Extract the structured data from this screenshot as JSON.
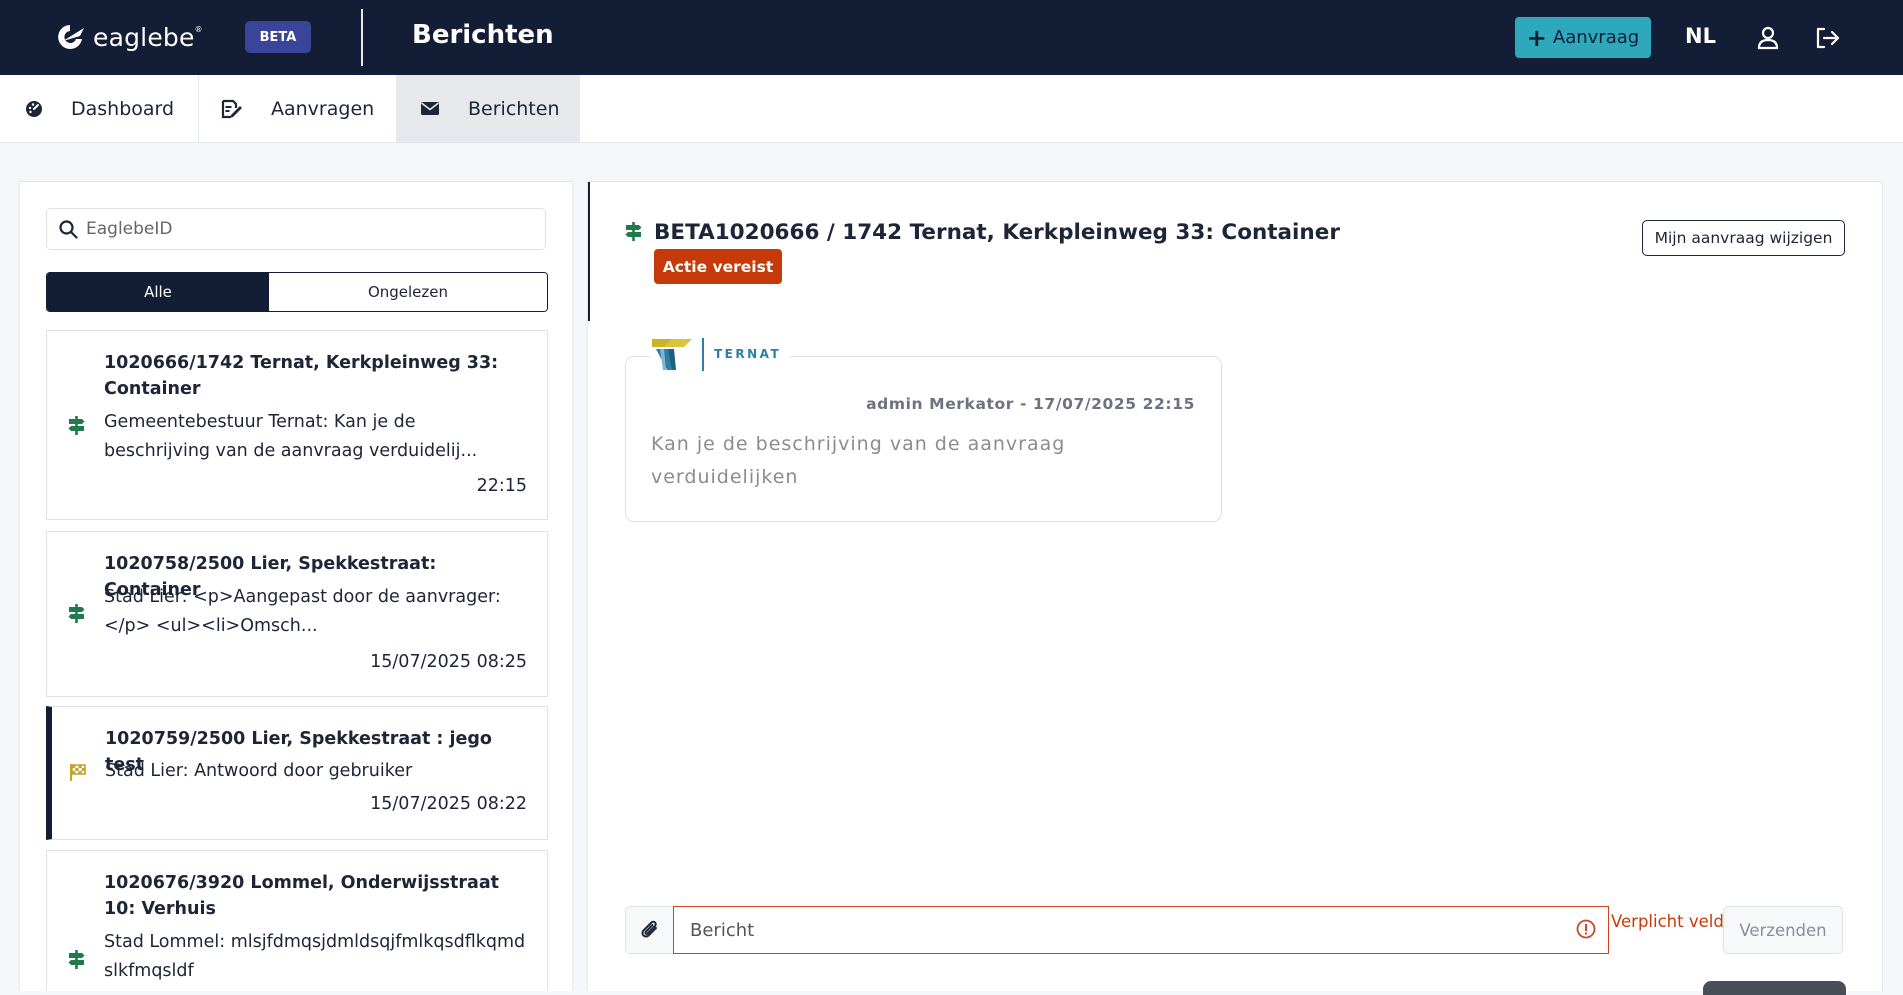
{
  "header": {
    "logo_text": "eaglebe",
    "logo_reg": "®",
    "beta_badge": "BETA",
    "page_title": "Berichten",
    "new_request_label": "Aanvraag",
    "language": "NL"
  },
  "nav": {
    "tabs": [
      {
        "label": "Dashboard",
        "icon": "dashboard-icon",
        "active": false
      },
      {
        "label": "Aanvragen",
        "icon": "edit-document-icon",
        "active": false
      },
      {
        "label": "Berichten",
        "icon": "envelope-icon",
        "active": true
      }
    ]
  },
  "sidebar": {
    "search_placeholder": "EaglebeID",
    "filters": {
      "all": "Alle",
      "unread": "Ongelezen"
    },
    "messages": [
      {
        "title": "1020666/1742 Ternat, Kerkpleinweg 33: Container",
        "preview": "Gemeentebestuur Ternat: Kan je de beschrijving van de aanvraag verduidelij...",
        "time": "22:15",
        "icon": "signpost-icon",
        "selected": false
      },
      {
        "title": "1020758/2500 Lier, Spekkestraat: Container",
        "preview": "Stad Lier: <p>Aangepast door de aanvrager: </p> <ul><li>Omsch...",
        "time": "15/07/2025 08:25",
        "icon": "signpost-icon",
        "selected": false
      },
      {
        "title": "1020759/2500 Lier, Spekkestraat : jego test",
        "preview": "Stad Lier: Antwoord door gebruiker",
        "time": "15/07/2025 08:22",
        "icon": "checkered-flag-icon",
        "selected": true
      },
      {
        "title": "1020676/3920 Lommel, Onderwijsstraat 10: Verhuis",
        "preview": "Stad Lommel: mlsjfdmqsjdmldsqjfmlkqsdflkqmdslkfmqsldf",
        "time": "",
        "icon": "signpost-icon",
        "selected": false
      }
    ]
  },
  "thread": {
    "title": "BETA1020666 / 1742 Ternat, Kerkpleinweg 33: Container",
    "status_badge": "Actie vereist",
    "edit_button": "Mijn aanvraag wijzigen",
    "messages": [
      {
        "org_name": "TERNAT",
        "meta": "admin Merkator - 17/07/2025 22:15",
        "text": "Kan je de beschrijving van de aanvraag verduidelijken"
      }
    ]
  },
  "composer": {
    "placeholder": "Bericht",
    "value": "",
    "error": "Verplicht veld.",
    "send_label": "Verzenden"
  },
  "colors": {
    "header_bg": "#141d36",
    "accent_teal": "#2ea8bb",
    "beta_badge": "#3a4599",
    "status_red": "#c53a08",
    "signpost_green": "#1f7a4c",
    "flag_gold": "#c9a227"
  }
}
